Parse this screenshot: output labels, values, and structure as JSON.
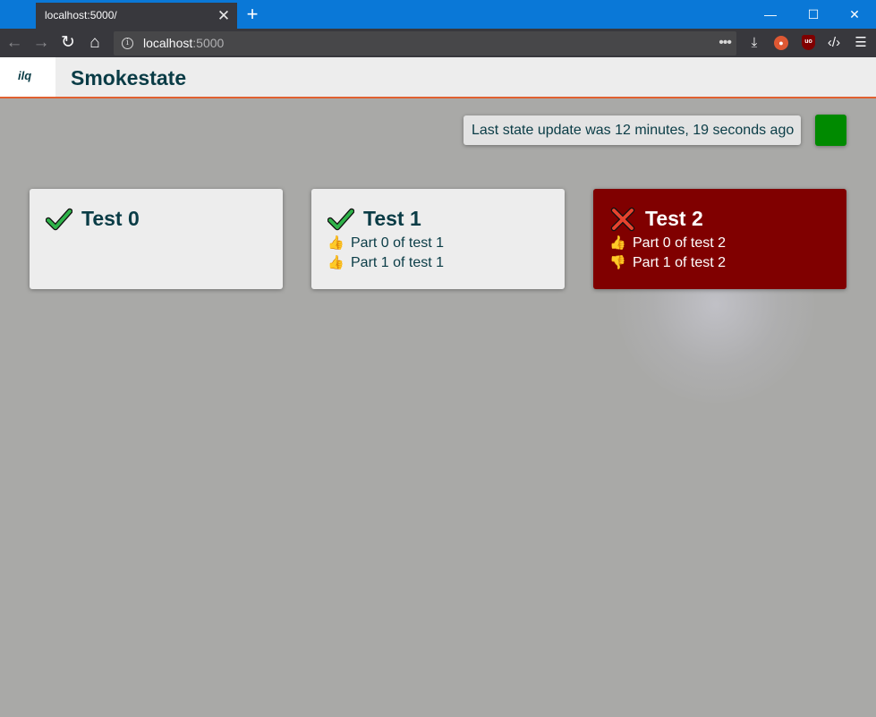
{
  "browser": {
    "tab_title": "localhost:5000/",
    "url_host": "localhost",
    "url_port": ":5000",
    "accent": "#0a78d7"
  },
  "app": {
    "logo": "ilq",
    "title": "Smokestate",
    "header_accent": "#e06030"
  },
  "status": {
    "text": "Last state update was 12 minutes, 19 seconds ago",
    "indicator_color": "#008a00"
  },
  "tests": [
    {
      "name": "Test 0",
      "status": "pass",
      "color": "#ededed",
      "text_color": "#0a3c46",
      "parts": []
    },
    {
      "name": "Test 1",
      "status": "pass",
      "color": "#ededed",
      "text_color": "#0a3c46",
      "parts": [
        {
          "label": "Part 0 of test 1",
          "result": "thumbs-up-icon"
        },
        {
          "label": "Part 1 of test 1",
          "result": "thumbs-up-icon"
        }
      ]
    },
    {
      "name": "Test 2",
      "status": "fail",
      "color": "#800000",
      "text_color": "#ffffff",
      "parts": [
        {
          "label": "Part 0 of test 2",
          "result": "thumbs-up-icon"
        },
        {
          "label": "Part 1 of test 2",
          "result": "thumbs-down-icon"
        }
      ]
    }
  ]
}
